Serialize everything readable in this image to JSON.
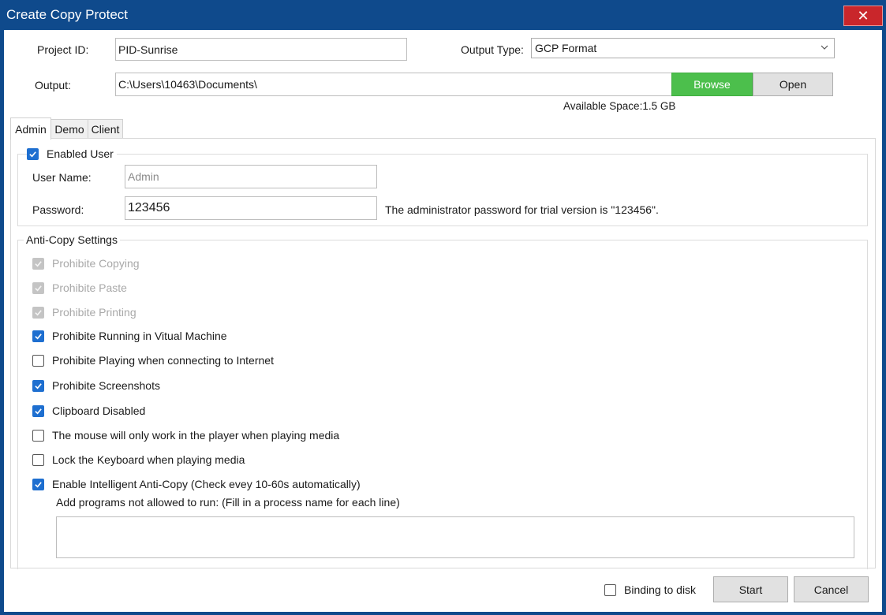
{
  "window": {
    "title": "Create Copy Protect",
    "close_glyph": "✕"
  },
  "project": {
    "id_label": "Project ID:",
    "id_value": "PID-Sunrise"
  },
  "output_type": {
    "label": "Output Type:",
    "selected": "GCP Format"
  },
  "output": {
    "label": "Output:",
    "path": "C:\\Users\\10463\\Documents\\",
    "browse_label": "Browse",
    "open_label": "Open",
    "available_space": "Available Space:1.5 GB"
  },
  "tabs": [
    {
      "label": "Admin",
      "active": true
    },
    {
      "label": "Demo",
      "active": false
    },
    {
      "label": "Client",
      "active": false
    }
  ],
  "user_group": {
    "enabled_label": "Enabled User",
    "enabled": true,
    "username_label": "User Name:",
    "username_value": "Admin",
    "password_label": "Password:",
    "password_value": "123456",
    "password_hint": "The administrator password for trial version is \"123456\"."
  },
  "anti_copy": {
    "legend": "Anti-Copy Settings",
    "options": [
      {
        "label": "Prohibite Copying",
        "state": "disabled"
      },
      {
        "label": "Prohibite Paste",
        "state": "disabled"
      },
      {
        "label": "Prohibite Printing",
        "state": "disabled"
      },
      {
        "label": "Prohibite Running in Vitual Machine",
        "state": "checked"
      },
      {
        "label": "Prohibite Playing when connecting to Internet",
        "state": "unchecked"
      },
      {
        "label": "Prohibite Screenshots",
        "state": "checked"
      },
      {
        "label": "Clipboard Disabled",
        "state": "checked"
      },
      {
        "label": "The mouse will only work in the player when playing media",
        "state": "unchecked"
      },
      {
        "label": "Lock the Keyboard when playing media",
        "state": "unchecked"
      },
      {
        "label": "Enable Intelligent Anti-Copy (Check evey 10-60s automatically)",
        "state": "checked"
      }
    ],
    "programs_label": "Add programs not allowed to run: (Fill in a process name for each line)",
    "programs_value": ""
  },
  "footer": {
    "binding_label": "Binding to disk",
    "binding_checked": false,
    "start_label": "Start",
    "cancel_label": "Cancel"
  },
  "colors": {
    "titlebar": "#0f4a8c",
    "close": "#c9262b",
    "browse": "#4cbf4c",
    "checkbox_checked": "#1e6fd0"
  }
}
